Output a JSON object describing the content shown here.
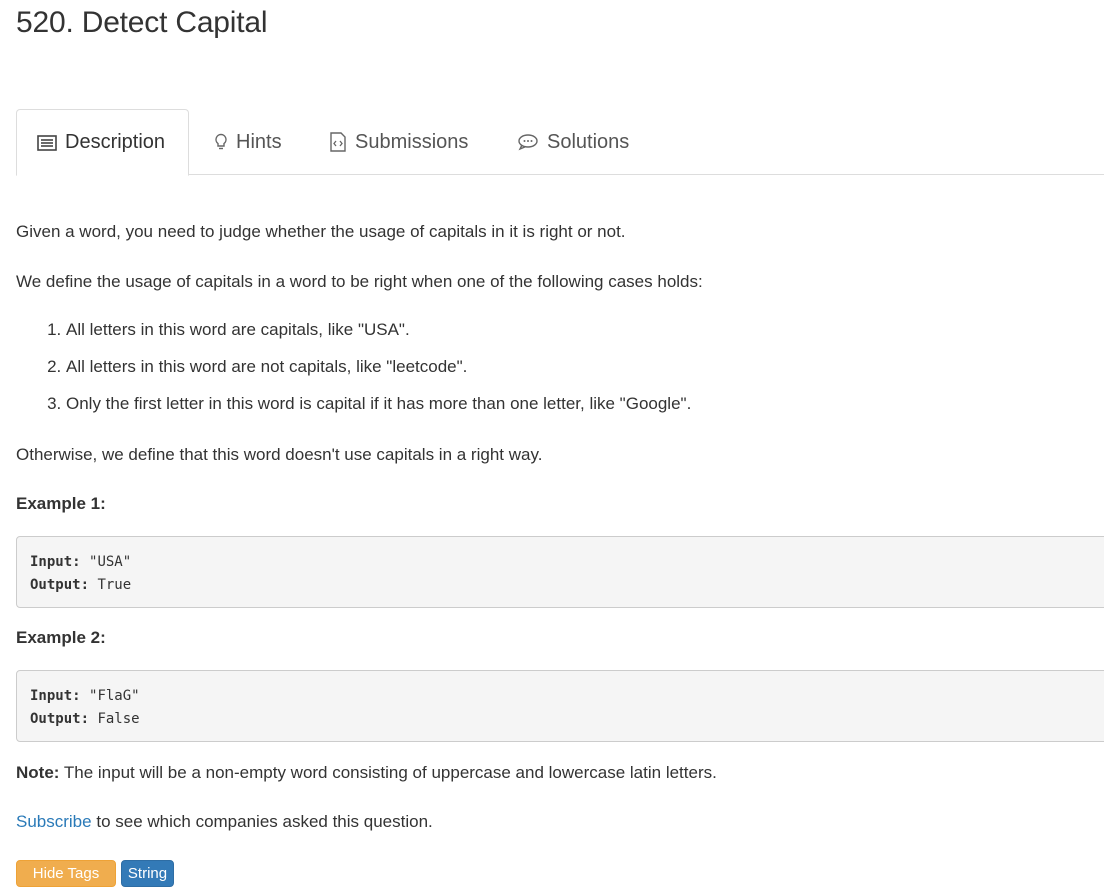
{
  "problem": {
    "title": "520. Detect Capital"
  },
  "tabs": [
    {
      "label": "Description",
      "icon": "list-icon",
      "active": true
    },
    {
      "label": "Hints",
      "icon": "lightbulb-icon"
    },
    {
      "label": "Submissions",
      "icon": "code-file-icon"
    },
    {
      "label": "Solutions",
      "icon": "chat-bubble-icon"
    }
  ],
  "description": {
    "intro": "Given a word, you need to judge whether the usage of capitals in it is right or not.",
    "define": "We define the usage of capitals in a word to be right when one of the following cases holds:",
    "cases": [
      "All letters in this word are capitals, like \"USA\".",
      "All letters in this word are not capitals, like \"leetcode\".",
      "Only the first letter in this word is capital if it has more than one letter, like \"Google\"."
    ],
    "otherwise": "Otherwise, we define that this word doesn't use capitals in a right way."
  },
  "examples": [
    {
      "title": "Example 1:",
      "input_label": "Input:",
      "input": "\"USA\"",
      "output_label": "Output:",
      "output": "True"
    },
    {
      "title": "Example 2:",
      "input_label": "Input:",
      "input": "\"FlaG\"",
      "output_label": "Output:",
      "output": "False"
    }
  ],
  "note": {
    "label": "Note:",
    "text": "The input will be a non-empty word consisting of uppercase and lowercase latin letters."
  },
  "subscribe": {
    "link": "Subscribe",
    "text": "to see which companies asked this question."
  },
  "buttons": {
    "hide_tags": "Hide Tags",
    "tag_string": "String"
  },
  "colors": {
    "link": "#2a7ab8",
    "hide_tags_bg": "#f0ad4e",
    "tag_bg": "#337ab7"
  }
}
